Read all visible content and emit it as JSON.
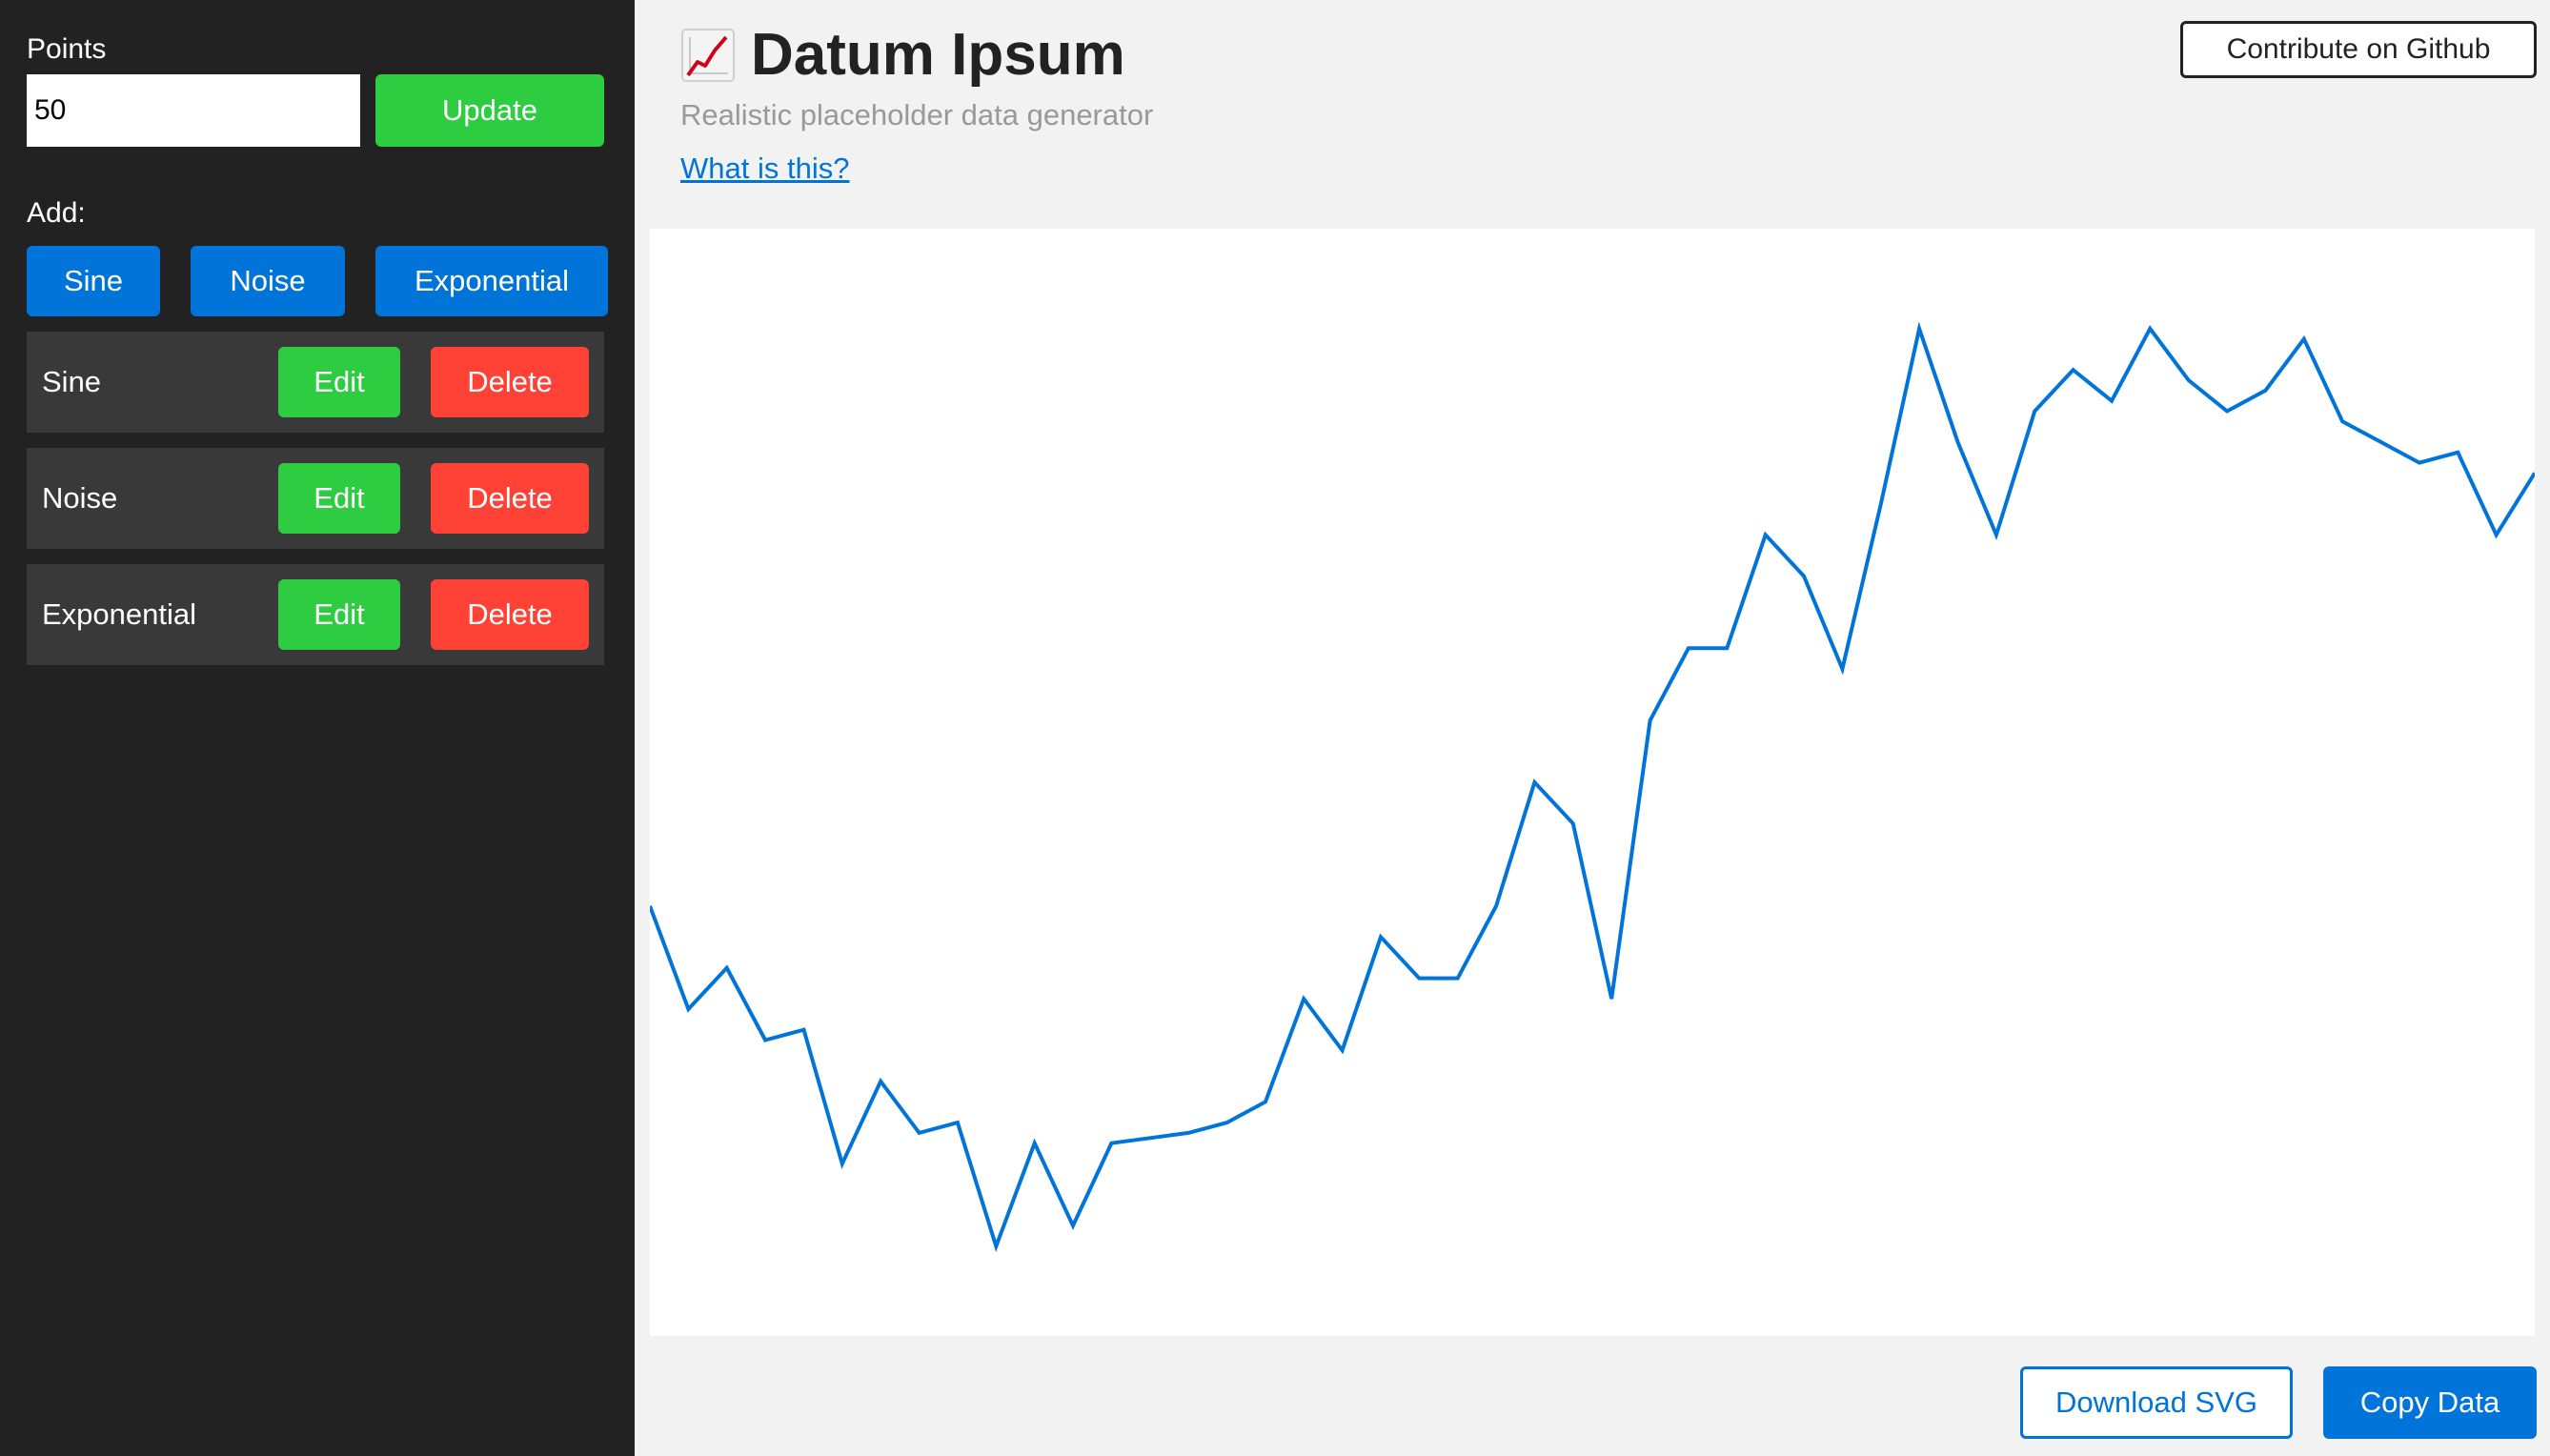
{
  "sidebar": {
    "points_label": "Points",
    "points_value": "50",
    "update_label": "Update",
    "add_label": "Add:",
    "add_buttons": {
      "sine": "Sine",
      "noise": "Noise",
      "exponential": "Exponential"
    },
    "layers": [
      {
        "name": "Sine",
        "edit": "Edit",
        "delete": "Delete"
      },
      {
        "name": "Noise",
        "edit": "Edit",
        "delete": "Delete"
      },
      {
        "name": "Exponential",
        "edit": "Edit",
        "delete": "Delete"
      }
    ]
  },
  "header": {
    "icon": "chart-increasing-icon",
    "title": "Datum Ipsum",
    "subtitle": "Realistic placeholder data generator",
    "what_link": "What is this?",
    "github_label": "Contribute on Github"
  },
  "footer": {
    "download_label": "Download SVG",
    "copy_label": "Copy Data"
  },
  "colors": {
    "line": "#0074d9",
    "green": "#2ecc40",
    "blue": "#0074d9",
    "red": "#ff4136",
    "sidebar_bg": "#222222",
    "layer_bg": "#393939"
  },
  "chart_data": {
    "type": "line",
    "x": [
      0,
      1,
      2,
      3,
      4,
      5,
      6,
      7,
      8,
      9,
      10,
      11,
      12,
      13,
      14,
      15,
      16,
      17,
      18,
      19,
      20,
      21,
      22,
      23,
      24,
      25,
      26,
      27,
      28,
      29,
      30,
      31,
      32,
      33,
      34,
      35,
      36,
      37,
      38,
      39,
      40,
      41,
      42,
      43,
      44,
      45,
      46,
      47,
      48,
      49
    ],
    "values": [
      0.38,
      0.28,
      0.32,
      0.25,
      0.26,
      0.13,
      0.21,
      0.16,
      0.17,
      0.05,
      0.15,
      0.07,
      0.15,
      0.155,
      0.16,
      0.17,
      0.19,
      0.29,
      0.24,
      0.35,
      0.31,
      0.31,
      0.38,
      0.5,
      0.46,
      0.29,
      0.56,
      0.63,
      0.63,
      0.74,
      0.7,
      0.61,
      0.77,
      0.94,
      0.83,
      0.74,
      0.86,
      0.9,
      0.87,
      0.94,
      0.89,
      0.86,
      0.88,
      0.93,
      0.85,
      0.83,
      0.81,
      0.82,
      0.74,
      0.8
    ],
    "ylim": [
      0,
      1
    ],
    "grid": false,
    "legend": "none"
  }
}
